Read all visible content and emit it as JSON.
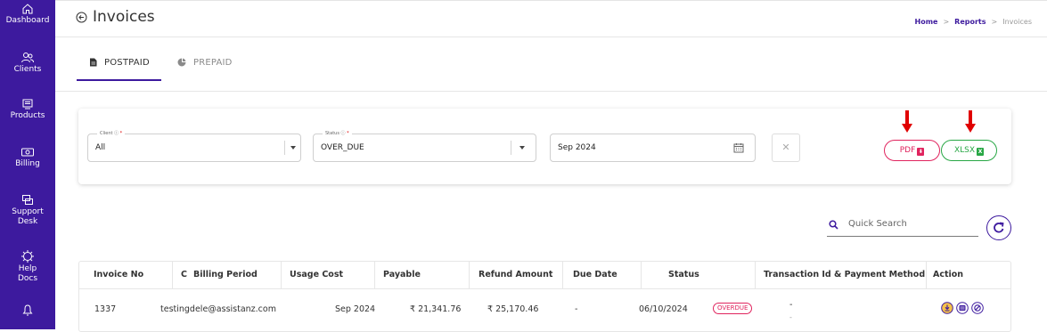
{
  "sidebar": {
    "items": [
      {
        "label": "Dashboard",
        "icon": "home-icon"
      },
      {
        "label": "Clients",
        "icon": "users-icon"
      },
      {
        "label": "Products",
        "icon": "products-icon"
      },
      {
        "label": "Billing",
        "icon": "billing-icon"
      },
      {
        "label": "Support Desk",
        "icon": "support-icon"
      },
      {
        "label": "Help Docs",
        "icon": "help-icon"
      },
      {
        "label": "",
        "icon": "notification-icon"
      }
    ]
  },
  "header": {
    "title": "Invoices",
    "breadcrumb": {
      "home": "Home",
      "sep": ">",
      "reports": "Reports",
      "current": "Invoices"
    }
  },
  "tabs": [
    {
      "label": "POSTPAID",
      "active": true
    },
    {
      "label": "PREPAID",
      "active": false
    }
  ],
  "filters": {
    "client": {
      "label": "Client",
      "value": "All"
    },
    "status": {
      "label": "Status",
      "value": "OVER_DUE"
    },
    "period": {
      "value": "Sep 2024"
    },
    "clear_label": "✕",
    "pdf_label": "PDF",
    "xlsx_label": "XLSX",
    "pdf_badge": "⬇",
    "xlsx_badge": "X"
  },
  "search": {
    "placeholder": "Quick Search"
  },
  "table": {
    "columns": [
      "Invoice No",
      "C",
      "Billing Period",
      "Usage Cost",
      "Payable",
      "Refund Amount",
      "Due Date",
      "Status",
      "Transaction Id & Payment Method",
      "Action"
    ],
    "rows": [
      {
        "invoice_no": "1337",
        "client": "testingdele@assistanz.com",
        "billing_period": "Sep 2024",
        "usage_cost": "₹ 21,341.76",
        "payable": "₹ 25,170.46",
        "refund": "-",
        "due_date": "06/10/2024",
        "status": "OVERDUE",
        "transaction": "-",
        "transaction_sub": "-"
      }
    ]
  },
  "colors": {
    "brand": "#3d1a9e",
    "pdf": "#e0245e",
    "xlsx": "#28a745",
    "annotation_arrow": "#e00000"
  }
}
